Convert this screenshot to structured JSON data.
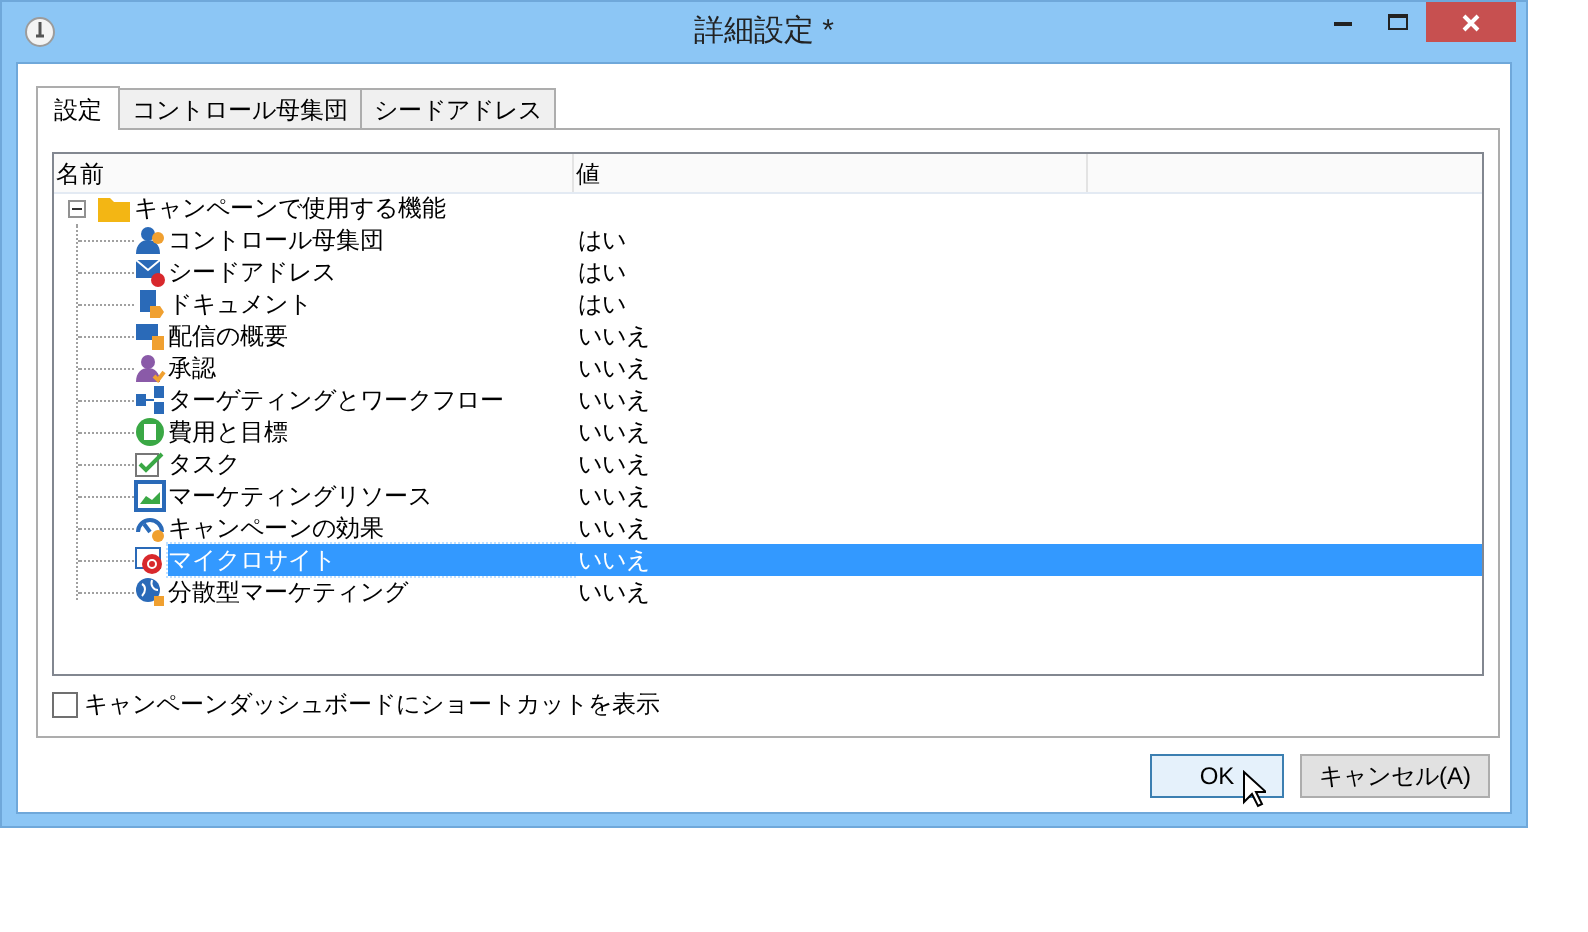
{
  "window": {
    "title": "詳細設定 *"
  },
  "tabs": [
    {
      "label": "設定",
      "selected": true
    },
    {
      "label": "コントロール母集団",
      "selected": false
    },
    {
      "label": "シードアドレス",
      "selected": false
    }
  ],
  "list": {
    "columns": [
      "名前",
      "値"
    ],
    "root": {
      "label": "キャンペーンで使用する機能",
      "expanded": true,
      "children": [
        {
          "label": "コントロール母集団",
          "value": "はい",
          "selected": false
        },
        {
          "label": "シードアドレス",
          "value": "はい",
          "selected": false
        },
        {
          "label": "ドキュメント",
          "value": "はい",
          "selected": false
        },
        {
          "label": "配信の概要",
          "value": "いいえ",
          "selected": false
        },
        {
          "label": "承認",
          "value": "いいえ",
          "selected": false
        },
        {
          "label": "ターゲティングとワークフロー",
          "value": "いいえ",
          "selected": false
        },
        {
          "label": "費用と目標",
          "value": "いいえ",
          "selected": false
        },
        {
          "label": "タスク",
          "value": "いいえ",
          "selected": false
        },
        {
          "label": "マーケティングリソース",
          "value": "いいえ",
          "selected": false
        },
        {
          "label": "キャンペーンの効果",
          "value": "いいえ",
          "selected": false
        },
        {
          "label": "マイクロサイト",
          "value": "いいえ",
          "selected": true
        },
        {
          "label": "分散型マーケティング",
          "value": "いいえ",
          "selected": false
        }
      ]
    }
  },
  "shortcut_checkbox": {
    "label": "キャンペーンダッシュボードにショートカットを表示",
    "checked": false
  },
  "buttons": [
    {
      "label": "OK",
      "default": true
    },
    {
      "label": "キャンセル(A)",
      "default": false
    }
  ]
}
